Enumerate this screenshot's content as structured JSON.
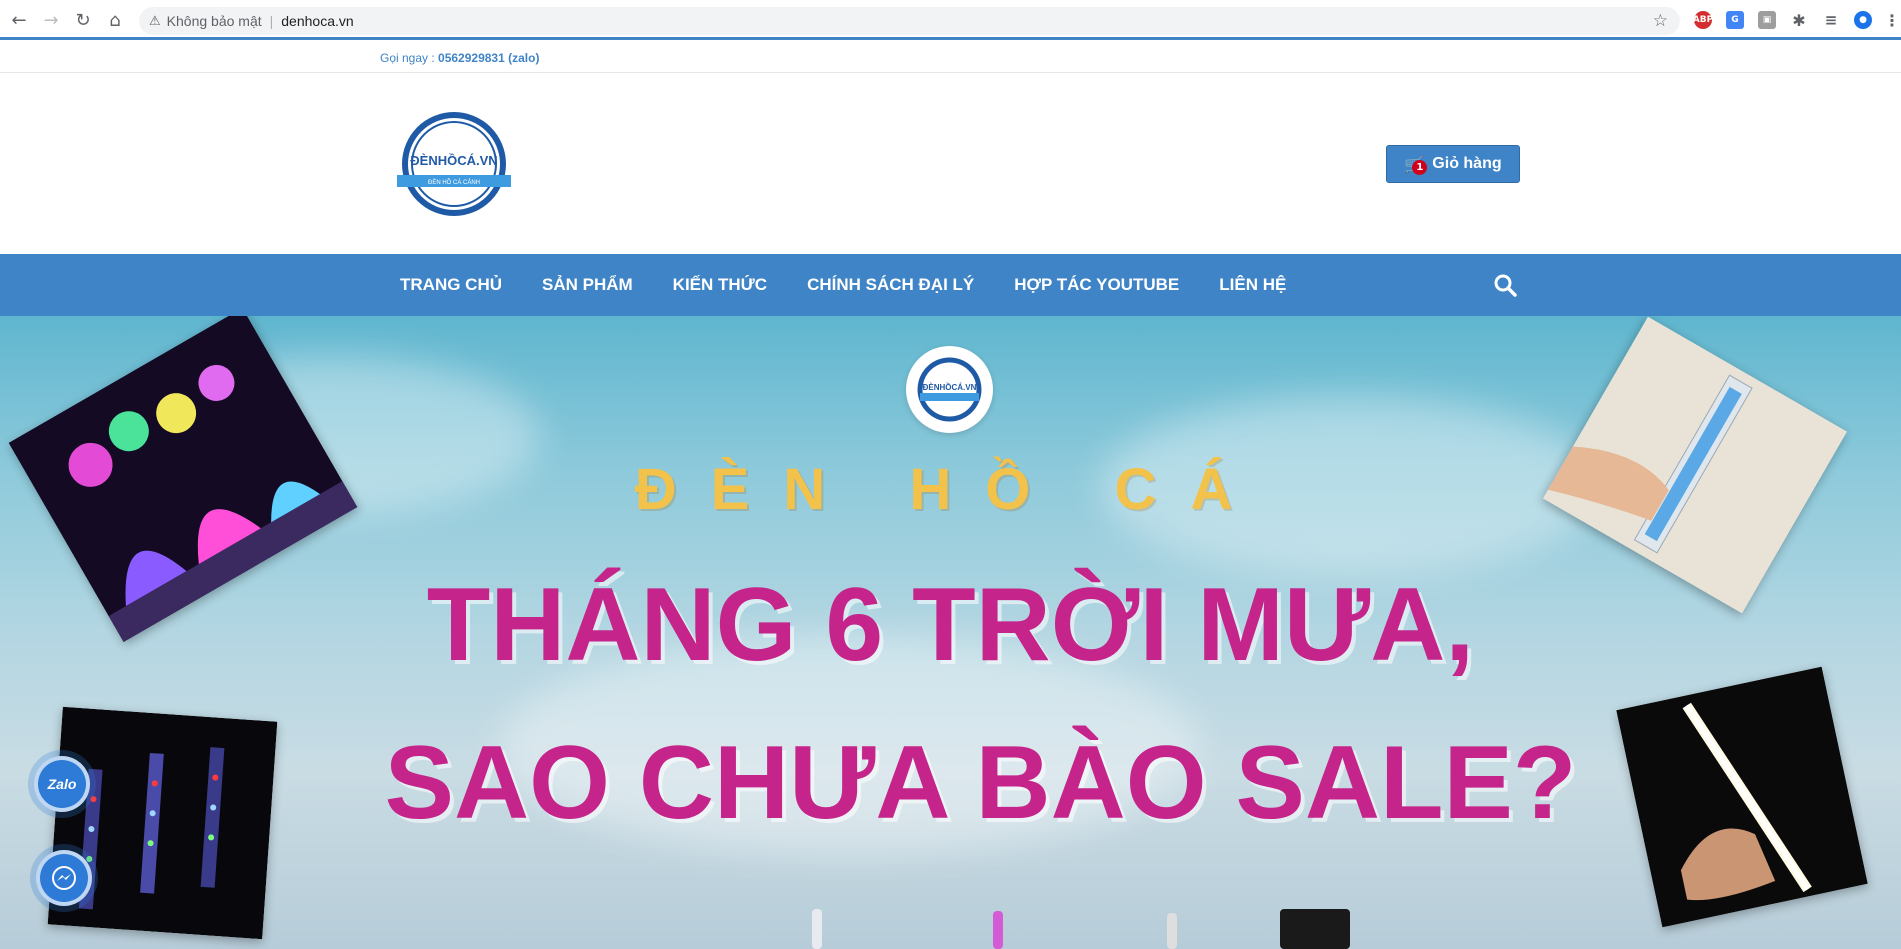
{
  "browser": {
    "security_label": "Không bảo mật",
    "url": "denhoca.vn",
    "separator": "|"
  },
  "topbar": {
    "call_prefix": "Gọi ngay : ",
    "call_number": "0562929831 (zalo)"
  },
  "header": {
    "logo_text": "ĐÈNHỒCÁ.VN",
    "logo_tagline": "ĐÈN HỒ CÁ CẢNH",
    "cart_label": "Giỏ hàng",
    "cart_count": "1"
  },
  "nav": {
    "items": [
      "TRANG CHỦ",
      "SẢN PHẨM",
      "KIẾN THỨC",
      "CHÍNH SÁCH ĐẠI LÝ",
      "HỢP TÁC YOUTUBE",
      "LIÊN HỆ"
    ]
  },
  "hero": {
    "subtitle": "ĐÈN HỒ CÁ",
    "line1": "THÁNG 6 TRỜI MƯA,",
    "line2": "SAO CHƯA BÀO SALE?"
  },
  "floating": {
    "zalo_label": "Zalo"
  },
  "colors": {
    "brand_blue": "#3f84c7",
    "headline_magenta": "#c5258a",
    "subtitle_gold": "#f3c24a",
    "badge_red": "#d0021b"
  }
}
